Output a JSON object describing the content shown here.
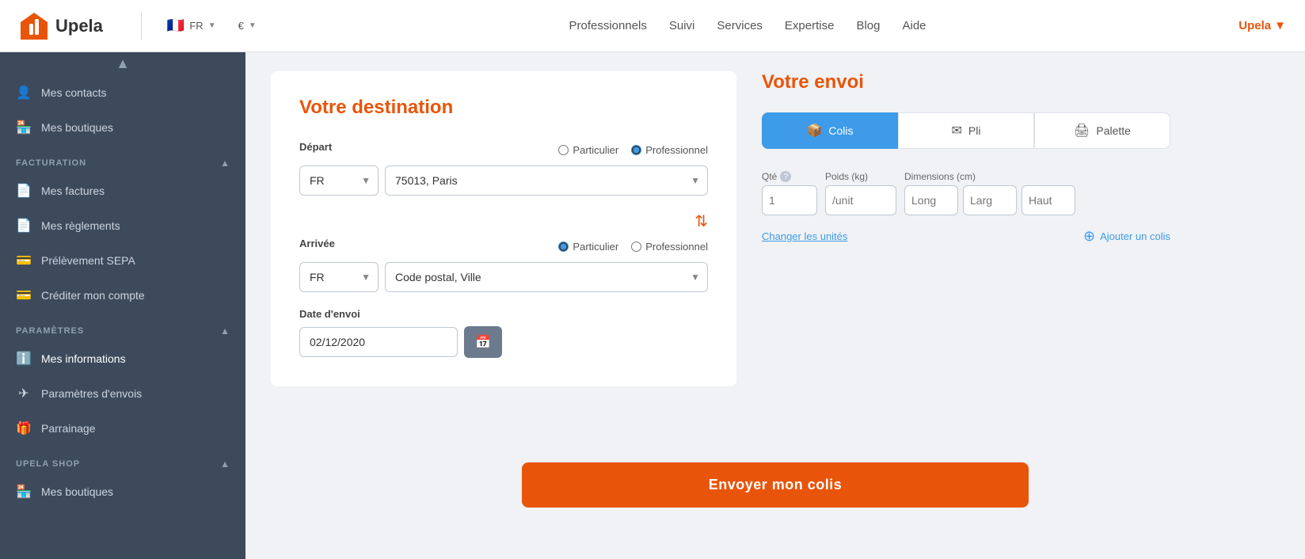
{
  "topnav": {
    "logo_text": "Upela",
    "lang": "FR",
    "currency": "€",
    "links": [
      "Professionnels",
      "Suivi",
      "Services",
      "Expertise",
      "Blog",
      "Aide"
    ],
    "user_label": "Upela"
  },
  "sidebar": {
    "sections": [
      {
        "id": "top",
        "label": null,
        "items": [
          {
            "id": "contacts",
            "label": "Mes contacts",
            "icon": "👤"
          },
          {
            "id": "boutiques-top",
            "label": "Mes boutiques",
            "icon": "🏪"
          }
        ]
      },
      {
        "id": "facturation",
        "label": "FACTURATION",
        "collapsible": true,
        "items": [
          {
            "id": "factures",
            "label": "Mes factures",
            "icon": "📄"
          },
          {
            "id": "reglements",
            "label": "Mes règlements",
            "icon": "📄"
          },
          {
            "id": "sepa",
            "label": "Prélèvement SEPA",
            "icon": "💳"
          },
          {
            "id": "credit",
            "label": "Créditer mon compte",
            "icon": "💳"
          }
        ]
      },
      {
        "id": "parametres",
        "label": "PARAMÈTRES",
        "collapsible": true,
        "items": [
          {
            "id": "informations",
            "label": "Mes informations",
            "icon": "ℹ️",
            "active": true
          },
          {
            "id": "envois",
            "label": "Paramètres d'envois",
            "icon": "✈"
          },
          {
            "id": "parrainage",
            "label": "Parrainage",
            "icon": "🎁"
          }
        ]
      },
      {
        "id": "upela-shop",
        "label": "UPELA SHOP",
        "collapsible": true,
        "items": [
          {
            "id": "boutiques-bottom",
            "label": "Mes boutiques",
            "icon": "🏪"
          }
        ]
      }
    ]
  },
  "destination": {
    "title": "Votre destination",
    "depart_label": "Départ",
    "depart_country": "FR",
    "depart_city": "75013, Paris",
    "depart_radio_particulier": "Particulier",
    "depart_radio_professionnel": "Professionnel",
    "depart_professionnel_selected": true,
    "arrivee_label": "Arrivée",
    "arrivee_country": "FR",
    "arrivee_city_placeholder": "Code postal, Ville",
    "arrivee_radio_particulier": "Particulier",
    "arrivee_radio_professionnel": "Professionnel",
    "arrivee_particulier_selected": true,
    "date_label": "Date d'envoi",
    "date_value": "02/12/2020"
  },
  "envoi": {
    "title": "Votre envoi",
    "tabs": [
      {
        "id": "colis",
        "label": "Colis",
        "icon": "📦",
        "active": true
      },
      {
        "id": "pli",
        "label": "Pli",
        "icon": "✉",
        "active": false
      },
      {
        "id": "palette",
        "label": "Palette",
        "icon": "🖨",
        "active": false
      }
    ],
    "qty_label": "Qté",
    "poids_label": "Poids (kg)",
    "dims_label": "Dimensions (cm)",
    "qty_placeholder": "1",
    "poids_placeholder": "/unit",
    "long_placeholder": "Long",
    "larg_placeholder": "Larg",
    "haut_placeholder": "Haut",
    "units_link": "Changer les unités",
    "add_colis_label": "Ajouter un colis"
  },
  "footer": {
    "send_button": "Envoyer mon colis"
  }
}
